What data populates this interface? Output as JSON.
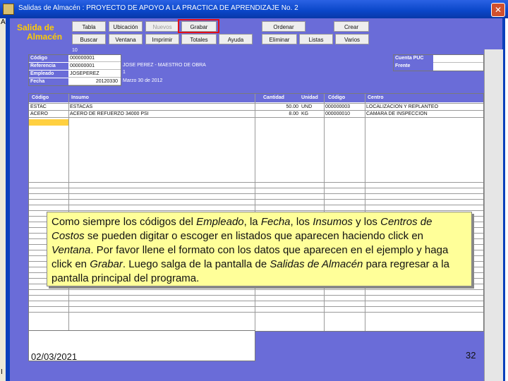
{
  "window": {
    "title": "Salidas de Almacén : PROYECTO DE APOYO A LA PRACTICA DE APRENDIZAJE No. 2",
    "close_label": "✕",
    "left_strip_letter": "A",
    "left_strip_bottom": "I"
  },
  "brand": {
    "line1": "Salida de",
    "line2": "Almacén"
  },
  "toolbar": {
    "row1": [
      {
        "label": "Tabla",
        "disabled": false
      },
      {
        "label": "Ubicación",
        "disabled": false
      },
      {
        "label": "Nuevos",
        "disabled": true
      },
      {
        "label": "Grabar",
        "disabled": false
      },
      {
        "label": "Ordenar",
        "disabled": false
      },
      {
        "label": "Crear",
        "disabled": false
      }
    ],
    "row2": [
      {
        "label": "Buscar",
        "disabled": false
      },
      {
        "label": "Ventana",
        "disabled": false
      },
      {
        "label": "Imprimir",
        "disabled": false
      },
      {
        "label": "Totales",
        "disabled": false
      },
      {
        "label": "Ayuda",
        "disabled": false
      },
      {
        "label": "Eliminar",
        "disabled": false
      },
      {
        "label": "Listas",
        "disabled": false
      },
      {
        "label": "Varios",
        "disabled": false
      }
    ]
  },
  "header_form": {
    "top_label": "10",
    "fields": [
      {
        "label": "Código",
        "value": "000000001"
      },
      {
        "label": "Referencia",
        "value": "000000001"
      },
      {
        "label": "Empleado",
        "value": "JOSEPEREZ"
      },
      {
        "label": "Fecha",
        "value": "20120330"
      }
    ],
    "employee_name": "JOSE PEREZ - MAESTRO DE OBRA",
    "employee_extra": "1",
    "date_text": "Marzo 30 de 2012",
    "cuenta_puc_label": "Cuenta PUC",
    "frente_label": "Frente"
  },
  "grid": {
    "headers": [
      "Código",
      "Insumo",
      "Cantidad",
      "Unidad",
      "Código",
      "Centro"
    ],
    "rows": [
      [
        "ESTAC",
        "ESTACAS",
        "50.00",
        "UND",
        "000000003",
        "LOCALIZACION Y REPLANTEO"
      ],
      [
        "ACERO",
        "ACERO DE REFUERZO 34000 PSI",
        "8.00",
        "KG",
        "000000010",
        "CAMARA DE INSPECCION"
      ]
    ]
  },
  "callout": {
    "parts": [
      {
        "text": "Como siempre los códigos del ",
        "italic": false
      },
      {
        "text": "Empleado",
        "italic": true
      },
      {
        "text": ", la ",
        "italic": false
      },
      {
        "text": "Fecha",
        "italic": true
      },
      {
        "text": ", los ",
        "italic": false
      },
      {
        "text": "Insumos",
        "italic": true
      },
      {
        "text": " y los ",
        "italic": false
      },
      {
        "text": "Centros de Costos",
        "italic": true
      },
      {
        "text": " se pueden digitar o escoger en listados que aparecen haciendo click en ",
        "italic": false
      },
      {
        "text": "Ventana",
        "italic": true
      },
      {
        "text": ". Por favor llene el formato con los datos que aparecen en el ejemplo y haga click en ",
        "italic": false
      },
      {
        "text": "Grabar",
        "italic": true
      },
      {
        "text": ". Luego salga de la pantalla de ",
        "italic": false
      },
      {
        "text": "Salidas de Almacén",
        "italic": true
      },
      {
        "text": " para regresar a la pantalla principal del programa.",
        "italic": false
      }
    ]
  },
  "footer": {
    "date": "02/03/2021",
    "page": "32"
  },
  "colors": {
    "title_bar": "#0a46c8",
    "client_bg": "#6a6cd8",
    "brand": "#ffcc00",
    "highlight": "#e0101a",
    "callout_bg": "#ffff99",
    "selected_cell": "#ffd040"
  }
}
